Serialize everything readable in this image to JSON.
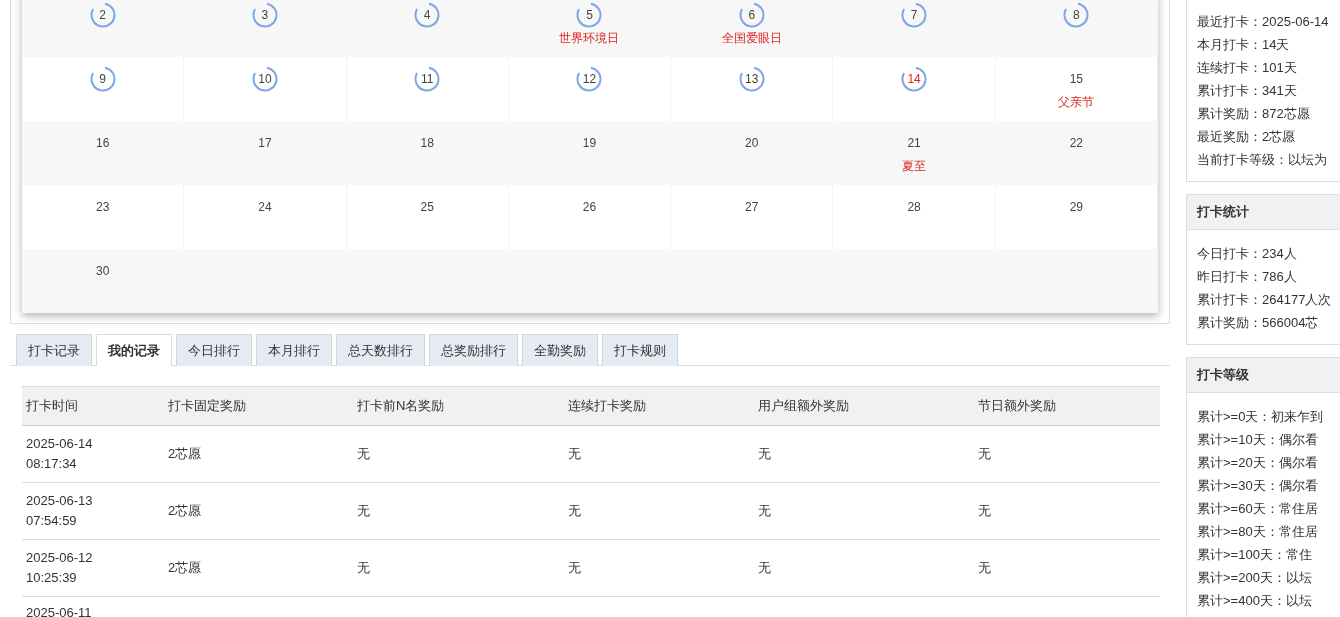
{
  "calendar": {
    "weeks": [
      [
        {
          "day": "2",
          "checked": true,
          "today": false
        },
        {
          "day": "3",
          "checked": true,
          "today": false
        },
        {
          "day": "4",
          "checked": true,
          "today": false
        },
        {
          "day": "5",
          "checked": true,
          "today": false,
          "holiday": "世界环境日"
        },
        {
          "day": "6",
          "checked": true,
          "today": false,
          "holiday": "全国爱眼日"
        },
        {
          "day": "7",
          "checked": true,
          "today": false
        },
        {
          "day": "8",
          "checked": true,
          "today": false
        }
      ],
      [
        {
          "day": "9",
          "checked": true,
          "today": false
        },
        {
          "day": "10",
          "checked": true,
          "today": false
        },
        {
          "day": "11",
          "checked": true,
          "today": false
        },
        {
          "day": "12",
          "checked": true,
          "today": false
        },
        {
          "day": "13",
          "checked": true,
          "today": false
        },
        {
          "day": "14",
          "checked": true,
          "today": true
        },
        {
          "day": "15",
          "checked": false,
          "today": false,
          "holiday": "父亲节"
        }
      ],
      [
        {
          "day": "16",
          "checked": false,
          "today": false
        },
        {
          "day": "17",
          "checked": false,
          "today": false
        },
        {
          "day": "18",
          "checked": false,
          "today": false
        },
        {
          "day": "19",
          "checked": false,
          "today": false
        },
        {
          "day": "20",
          "checked": false,
          "today": false
        },
        {
          "day": "21",
          "checked": false,
          "today": false,
          "holiday": "夏至"
        },
        {
          "day": "22",
          "checked": false,
          "today": false
        }
      ],
      [
        {
          "day": "23",
          "checked": false,
          "today": false
        },
        {
          "day": "24",
          "checked": false,
          "today": false
        },
        {
          "day": "25",
          "checked": false,
          "today": false
        },
        {
          "day": "26",
          "checked": false,
          "today": false
        },
        {
          "day": "27",
          "checked": false,
          "today": false
        },
        {
          "day": "28",
          "checked": false,
          "today": false
        },
        {
          "day": "29",
          "checked": false,
          "today": false
        }
      ],
      [
        {
          "day": "30",
          "checked": false,
          "today": false
        }
      ]
    ]
  },
  "tabs": [
    {
      "label": "打卡记录",
      "selected": false
    },
    {
      "label": "我的记录",
      "selected": true
    },
    {
      "label": "今日排行",
      "selected": false
    },
    {
      "label": "本月排行",
      "selected": false
    },
    {
      "label": "总天数排行",
      "selected": false
    },
    {
      "label": "总奖励排行",
      "selected": false
    },
    {
      "label": "全勤奖励",
      "selected": false
    },
    {
      "label": "打卡规则",
      "selected": false
    }
  ],
  "table": {
    "columns": [
      "打卡时间",
      "打卡固定奖励",
      "打卡前N名奖励",
      "连续打卡奖励",
      "用户组额外奖励",
      "节日额外奖励"
    ],
    "rows": [
      {
        "date": "2025-06-14",
        "time": "08:17:34",
        "cells": [
          "2芯愿",
          "无",
          "无",
          "无",
          "无"
        ]
      },
      {
        "date": "2025-06-13",
        "time": "07:54:59",
        "cells": [
          "2芯愿",
          "无",
          "无",
          "无",
          "无"
        ]
      },
      {
        "date": "2025-06-12",
        "time": "10:25:39",
        "cells": [
          "2芯愿",
          "无",
          "无",
          "无",
          "无"
        ]
      },
      {
        "date": "2025-06-11"
      }
    ]
  },
  "sidebar": {
    "my_stats": {
      "lines": [
        "最近打卡：2025-06-14",
        "本月打卡：14天",
        "连续打卡：101天",
        "累计打卡：341天",
        "累计奖励：872芯愿",
        "最近奖励：2芯愿",
        "当前打卡等级：以坛为"
      ]
    },
    "stats": {
      "title": "打卡统计",
      "lines": [
        "今日打卡：234人",
        "昨日打卡：786人",
        "累计打卡：264177人次",
        "累计奖励：566004芯"
      ]
    },
    "levels": {
      "title": "打卡等级",
      "lines": [
        "累计>=0天：初来乍到",
        "累计>=10天：偶尔看",
        "累计>=20天：偶尔看",
        "累计>=30天：偶尔看",
        "累计>=60天：常住居",
        "累计>=80天：常住居",
        "累计>=100天：常住",
        "累计>=200天：以坛",
        "累计>=400天：以坛"
      ]
    }
  }
}
